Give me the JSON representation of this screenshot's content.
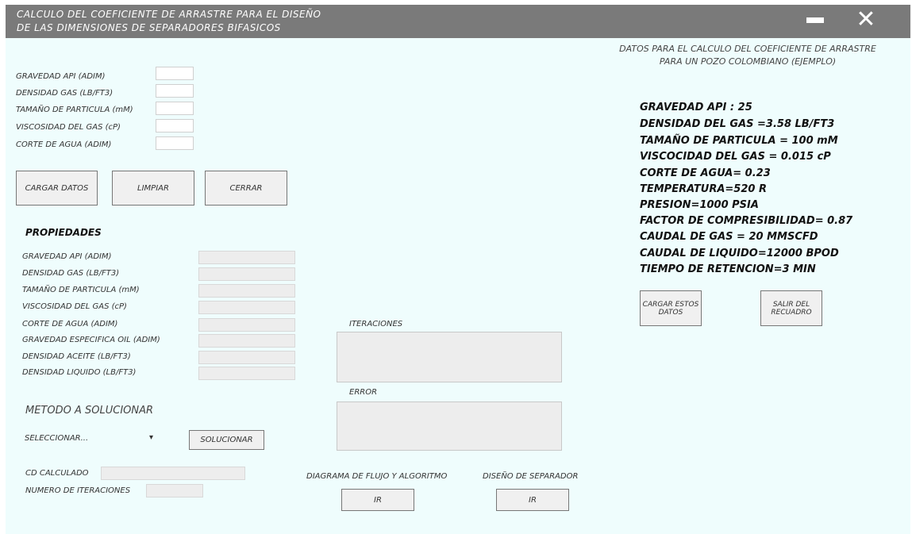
{
  "window": {
    "title_line1": "CALCULO DEL COEFICIENTE DE ARRASTRE PARA EL DISEÑO",
    "title_line2": "DE LAS DIMENSIONES DE SEPARADORES BIFASICOS",
    "minimize_icon": "minimize-icon",
    "close_icon": "close-icon",
    "close_glyph": "✕"
  },
  "inputs": {
    "labels": [
      "GRAVEDAD API (ADIM)",
      "DENSIDAD GAS (LB/FT3)",
      "TAMAÑO DE PARTICULA (mM)",
      "VISCOSIDAD DEL GAS (cP)",
      "CORTE DE AGUA (ADIM)"
    ],
    "values": [
      "",
      "",
      "",
      "",
      ""
    ]
  },
  "buttons": {
    "load": "CARGAR DATOS",
    "clear": "LIMPIAR",
    "close": "CERRAR",
    "solve": "SOLUCIONAR",
    "load_example": [
      "CARGAR ESTOS",
      "DATOS"
    ],
    "exit_panel": [
      "SALIR DEL",
      "RECUADRO"
    ],
    "go_flow": "IR",
    "go_separator": "IR"
  },
  "properties": {
    "heading": "PROPIEDADES",
    "labels": [
      "GRAVEDAD API (ADIM)",
      "DENSIDAD GAS (LB/FT3)",
      "TAMAÑO DE PARTICULA (mM)",
      "VISCOSIDAD DEL GAS (cP)",
      "CORTE DE AGUA (ADIM)",
      "GRAVEDAD ESPECIFICA OIL (ADIM)",
      "DENSIDAD ACEITE (LB/FT3)",
      "DENSIDAD LIQUIDO  (LB/FT3)"
    ],
    "values": [
      "",
      "",
      "",
      "",
      "",
      "",
      "",
      ""
    ]
  },
  "method": {
    "label": "METODO A SOLUCIONAR",
    "selected": "SELECCIONAR...",
    "arrow": "▾"
  },
  "results": {
    "cd_label": "CD CALCULADO",
    "cd_value": "",
    "iter_label": "NUMERO DE ITERACIONES",
    "iter_value": ""
  },
  "panels": {
    "iterations": "ITERACIONES",
    "error": "ERROR",
    "flow_diagram": "DIAGRAMA DE FLUJO Y ALGORITMO",
    "separator_design": "DISEÑO DE SEPARADOR"
  },
  "example": {
    "header_line1": "DATOS PARA EL CALCULO DEL COEFICIENTE DE ARRASTRE",
    "header_line2": "PARA UN POZO COLOMBIANO (EJEMPLO)",
    "lines": [
      "GRAVEDAD API : 25",
      "DENSIDAD DEL GAS =3.58 LB/FT3",
      "TAMAÑO DE PARTICULA = 100 mM",
      "VISCOCIDAD DEL GAS = 0.015 cP",
      "CORTE DE AGUA= 0.23",
      "TEMPERATURA=520 R",
      "PRESION=1000 PSIA",
      "FACTOR DE COMPRESIBILIDAD= 0.87",
      "CAUDAL DE GAS = 20 MMSCFD",
      "CAUDAL DE LIQUIDO=12000 BPOD",
      "TIEMPO DE RETENCION=3 MIN"
    ]
  },
  "colors": {
    "titlebar": "#7a7a7a",
    "background": "#effdfd",
    "field_readonly": "#ededed"
  }
}
